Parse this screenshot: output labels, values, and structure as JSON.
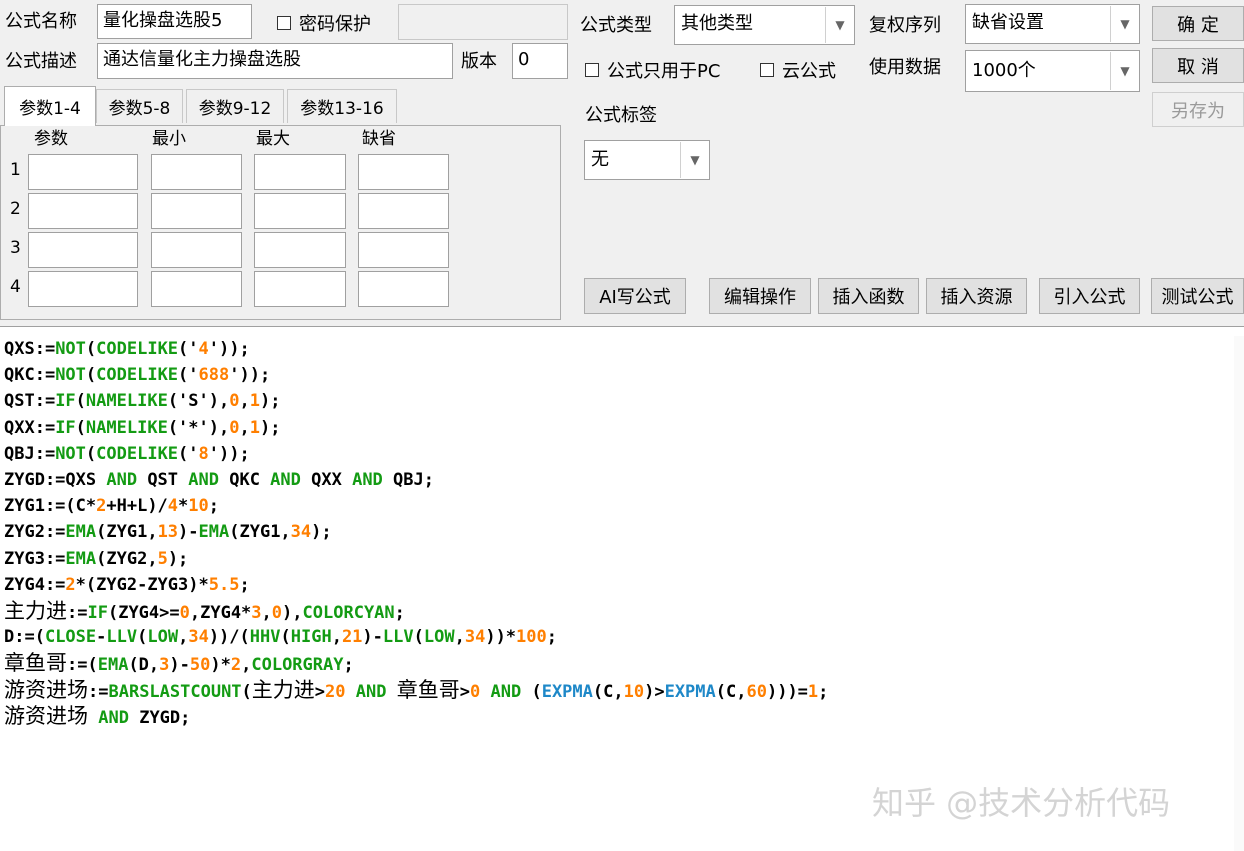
{
  "form": {
    "name_label": "公式名称",
    "name_value": "量化操盘选股5",
    "password_label": "密码保护",
    "password_value": "",
    "desc_label": "公式描述",
    "desc_value": "通达信量化主力操盘选股",
    "version_label": "版本",
    "version_value": "0",
    "type_label": "公式类型",
    "type_value": "其他类型",
    "pc_only_label": "公式只用于PC",
    "cloud_label": "云公式",
    "rights_label": "复权序列",
    "rights_value": "缺省设置",
    "data_label": "使用数据",
    "data_value": "1000个",
    "tag_label": "公式标签",
    "tag_value": "无"
  },
  "buttons": {
    "ok": "确  定",
    "cancel": "取  消",
    "save_as": "另存为",
    "ai_write": "AI写公式",
    "edit_ops": "编辑操作",
    "insert_func": "插入函数",
    "insert_res": "插入资源",
    "import_formula": "引入公式",
    "test_formula": "测试公式"
  },
  "params": {
    "tabs": [
      "参数1-4",
      "参数5-8",
      "参数9-12",
      "参数13-16"
    ],
    "headers": [
      "参数",
      "最小",
      "最大",
      "缺省"
    ],
    "rows": [
      "1",
      "2",
      "3",
      "4"
    ]
  },
  "code_lines": [
    "QXS:=NOT(CODELIKE('4'));",
    "QKC:=NOT(CODELIKE('688'));",
    "QST:=IF(NAMELIKE('S'),0,1);",
    "QXX:=IF(NAMELIKE('*'),0,1);",
    "QBJ:=NOT(CODELIKE('8'));",
    "ZYGD:=QXS AND QST AND QKC AND QXX AND QBJ;",
    "ZYG1:=(C*2+H+L)/4*10;",
    "ZYG2:=EMA(ZYG1,13)-EMA(ZYG1,34);",
    "ZYG3:=EMA(ZYG2,5);",
    "ZYG4:=2*(ZYG2-ZYG3)*5.5;",
    "主力进:=IF(ZYG4>=0,ZYG4*3,0),COLORCYAN;",
    "D:=(CLOSE-LLV(LOW,34))/(HHV(HIGH,21)-LLV(LOW,34))*100;",
    "章鱼哥:=(EMA(D,3)-50)*2,COLORGRAY;",
    "游资进场:=BARSLASTCOUNT(主力进>20 AND 章鱼哥>0 AND (EXPMA(C,10)>EXPMA(C,60)))=1;",
    "游资进场 AND ZYGD;"
  ],
  "watermark": "知乎 @技术分析代码",
  "colors": {
    "keyword": "#139b13",
    "number": "#ff7f00",
    "expma": "#1e88c8"
  }
}
